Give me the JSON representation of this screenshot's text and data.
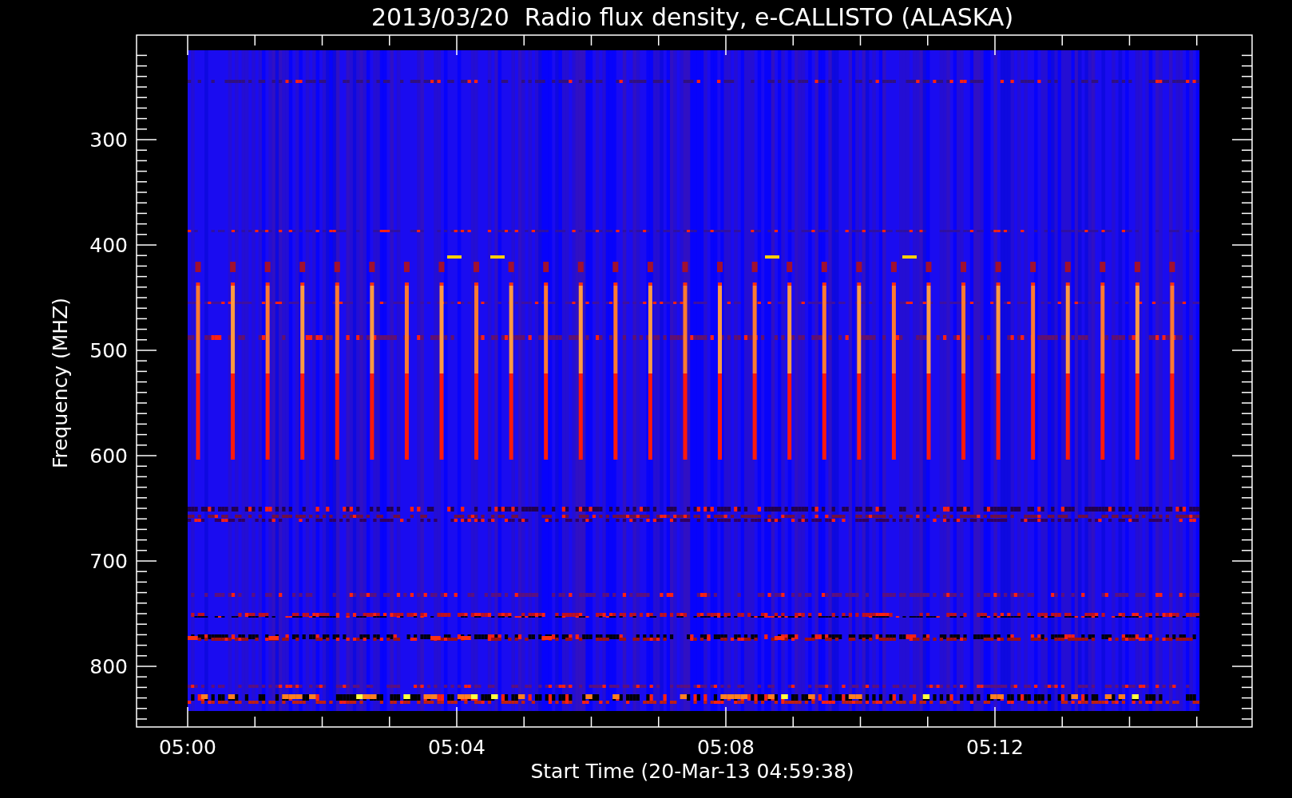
{
  "chart": {
    "title": "2013/03/20  Radio flux density, e-CALLISTO (ALASKA)",
    "y_axis": {
      "label": "Frequency (MHZ)",
      "tick_labels": [
        "300",
        "400",
        "500",
        "600",
        "700",
        "800"
      ]
    },
    "x_axis": {
      "label": "Start Time (20-Mar-13 04:59:38)",
      "tick_labels": [
        "05:00",
        "05:04",
        "05:08",
        "05:12"
      ]
    }
  }
}
